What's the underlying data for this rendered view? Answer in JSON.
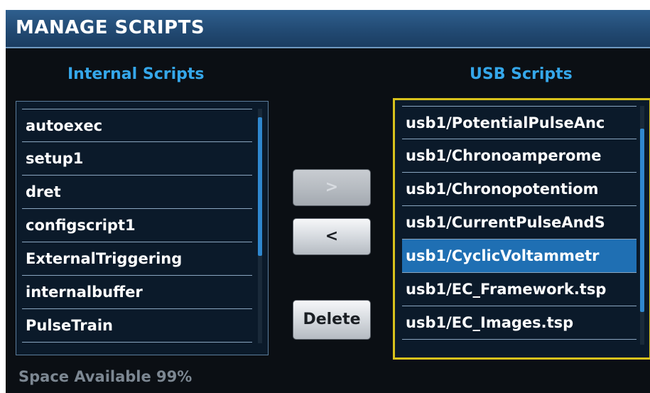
{
  "title": "MANAGE SCRIPTS",
  "internal": {
    "header": "Internal Scripts",
    "items": [
      {
        "label": "autoexec"
      },
      {
        "label": "setup1"
      },
      {
        "label": "dret"
      },
      {
        "label": "configscript1"
      },
      {
        "label": "ExternalTriggering"
      },
      {
        "label": "internalbuffer"
      },
      {
        "label": "PulseTrain"
      }
    ]
  },
  "usb": {
    "header": "USB Scripts",
    "items": [
      {
        "label": "usb1/PotentialPulseAnc"
      },
      {
        "label": "usb1/Chronoamperome"
      },
      {
        "label": "usb1/Chronopotentiom "
      },
      {
        "label": "usb1/CurrentPulseAndS"
      },
      {
        "label": "usb1/CyclicVoltammetr",
        "selected": true
      },
      {
        "label": "usb1/EC_Framework.tsp"
      },
      {
        "label": "usb1/EC_Images.tsp"
      }
    ]
  },
  "buttons": {
    "move_right": ">",
    "move_left": "<",
    "delete": "Delete"
  },
  "space_available": "Space Available  99%",
  "colors": {
    "accent": "#35a7ea",
    "selection": "#1f6fb3",
    "focus_border": "#d8c21c"
  }
}
